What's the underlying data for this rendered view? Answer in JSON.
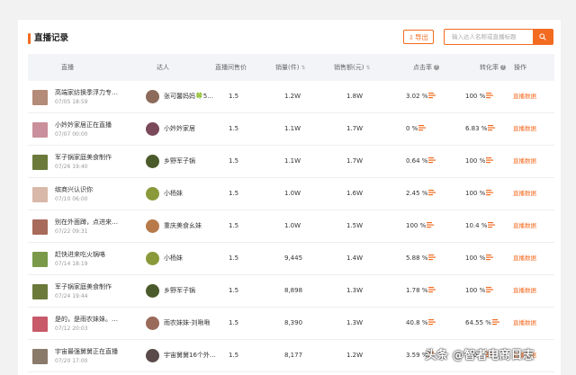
{
  "section": {
    "title": "直播记录"
  },
  "toolbar": {
    "export_label": "导出"
  },
  "search": {
    "placeholder": "输入达人名称或直播标题"
  },
  "table": {
    "columns": [
      "直播",
      "达人",
      "直播间售价",
      "销量(件)",
      "销售额(元)",
      "点击率",
      "转化率",
      "操作"
    ],
    "rows": [
      {
        "title": "高端家纺换季浮力专…",
        "time": "07/05 18:59",
        "talent": "张可馨妈妈🍀5…",
        "price": "1.5",
        "sales": "1.2W",
        "revenue": "1.8W",
        "ctr": "3.02 %",
        "cvr": "100 %",
        "op": "直播数据",
        "thumb_color": "#b48a78",
        "avatar_color": "#8c6b5a"
      },
      {
        "title": "小妗妗家居正在直播",
        "time": "07/07 00:00",
        "talent": "小妗妗家居",
        "price": "1.5",
        "sales": "1.1W",
        "revenue": "1.7W",
        "ctr": "0 %",
        "cvr": "6.83 %",
        "op": "直播数据",
        "thumb_color": "#c98f9b",
        "avatar_color": "#7a4a5a"
      },
      {
        "title": "军子锅家庭美食制作",
        "time": "07/26 19:40",
        "talent": "乡野军子锅",
        "price": "1.5",
        "sales": "1.1W",
        "revenue": "1.7W",
        "ctr": "0.64 %",
        "cvr": "100 %",
        "op": "直播数据",
        "thumb_color": "#6b7a3a",
        "avatar_color": "#4a5a2a"
      },
      {
        "title": "缤商兴认识你",
        "time": "07/10 06:00",
        "talent": "小杨妹",
        "price": "1.5",
        "sales": "1.0W",
        "revenue": "1.6W",
        "ctr": "2.45 %",
        "cvr": "100 %",
        "op": "直播数据",
        "thumb_color": "#d8b8a8",
        "avatar_color": "#8a9a3a"
      },
      {
        "title": "别在外面蹲，点进来…",
        "time": "07/22 09:31",
        "talent": "重庆美食幺妹",
        "price": "1.5",
        "sales": "1.0W",
        "revenue": "1.5W",
        "ctr": "100 %",
        "cvr": "10.4 %",
        "op": "直播数据",
        "thumb_color": "#a86a5a",
        "avatar_color": "#b87a4a"
      },
      {
        "title": "赶快进来吃火锅咯",
        "time": "07/14 18:19",
        "talent": "小杨妹",
        "price": "1.5",
        "sales": "9,445",
        "revenue": "1.4W",
        "ctr": "5.88 %",
        "cvr": "100 %",
        "op": "直播数据",
        "thumb_color": "#7a9a4a",
        "avatar_color": "#8a9a3a"
      },
      {
        "title": "军子锅家庭美食制作",
        "time": "07/24 19:44",
        "talent": "乡野军子锅",
        "price": "1.5",
        "sales": "8,898",
        "revenue": "1.3W",
        "ctr": "1.78 %",
        "cvr": "100 %",
        "op": "直播数据",
        "thumb_color": "#6b7a3a",
        "avatar_color": "#4a5a2a"
      },
      {
        "title": "是的，是雨农妹妹。…",
        "time": "07/12 20:03",
        "talent": "雨农妹妹-刘啾啾",
        "price": "1.5",
        "sales": "8,390",
        "revenue": "1.3W",
        "ctr": "40.8 %",
        "cvr": "64.55 %",
        "op": "直播数据",
        "thumb_color": "#c85a6a",
        "avatar_color": "#9a6a5a"
      },
      {
        "title": "宇宙最强舅舅正在直播",
        "time": "07/20 17:00",
        "talent": "宇宙舅舅16个外…",
        "price": "1.5",
        "sales": "8,177",
        "revenue": "1.2W",
        "ctr": "3.59 %",
        "cvr": "100 %",
        "op": "直播数据",
        "thumb_color": "#8a7a6a",
        "avatar_color": "#5a4a4a"
      }
    ]
  },
  "watermark": {
    "text": "头条 @智者电商日志"
  },
  "colors": {
    "accent": "#f36b21",
    "header_bg": "#f3f4f8"
  }
}
